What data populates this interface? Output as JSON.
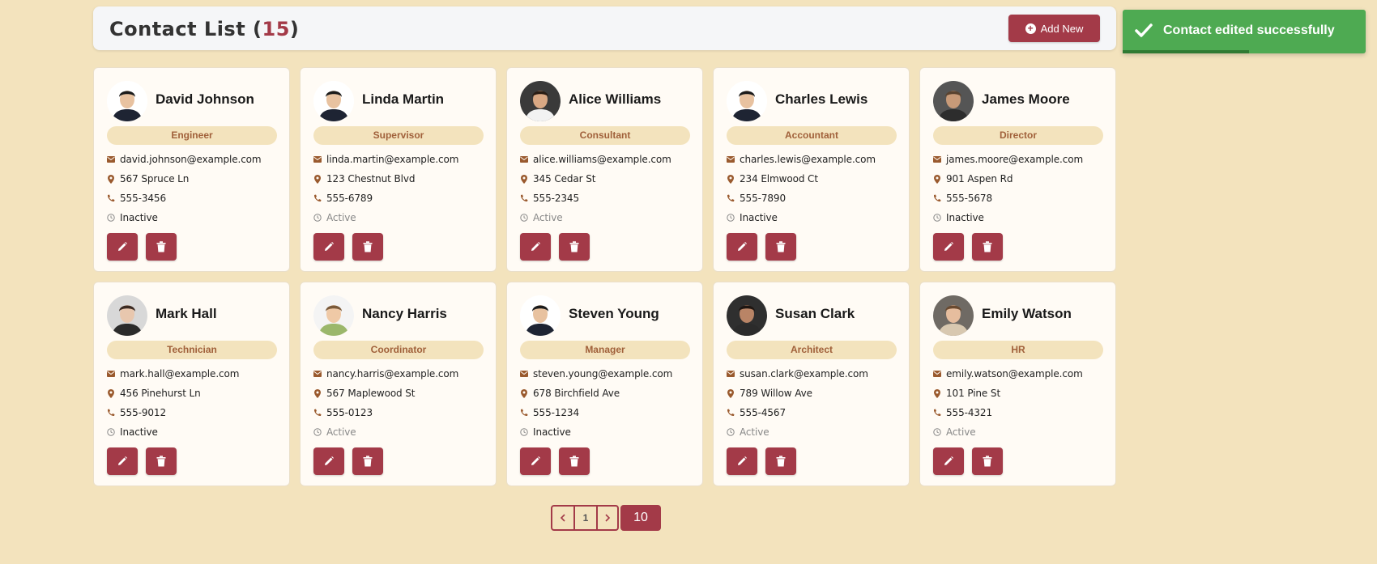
{
  "header": {
    "title": "Contact List",
    "count_open": "(",
    "count": "15",
    "count_close": ")",
    "add_label": "Add New"
  },
  "toast": {
    "message": "Contact edited successfully",
    "progress": 0.52
  },
  "colors": {
    "accent": "#a33a48",
    "background": "#f3e3bd",
    "toast": "#4eaa52",
    "role_text": "#a0603a"
  },
  "contacts": [
    {
      "name": "David Johnson",
      "role": "Engineer",
      "email": "david.johnson@example.com",
      "address": "567 Spruce Ln",
      "phone": "555-3456",
      "status": "Inactive",
      "avatar": "man-a"
    },
    {
      "name": "Linda Martin",
      "role": "Supervisor",
      "email": "linda.martin@example.com",
      "address": "123 Chestnut Blvd",
      "phone": "555-6789",
      "status": "Active",
      "avatar": "man-a"
    },
    {
      "name": "Alice Williams",
      "role": "Consultant",
      "email": "alice.williams@example.com",
      "address": "345 Cedar St",
      "phone": "555-2345",
      "status": "Active",
      "avatar": "footballer"
    },
    {
      "name": "Charles Lewis",
      "role": "Accountant",
      "email": "charles.lewis@example.com",
      "address": "234 Elmwood Ct",
      "phone": "555-7890",
      "status": "Inactive",
      "avatar": "man-a"
    },
    {
      "name": "James Moore",
      "role": "Director",
      "email": "james.moore@example.com",
      "address": "901 Aspen Rd",
      "phone": "555-5678",
      "status": "Inactive",
      "avatar": "man-curly"
    },
    {
      "name": "Mark Hall",
      "role": "Technician",
      "email": "mark.hall@example.com",
      "address": "456 Pinehurst Ln",
      "phone": "555-9012",
      "status": "Inactive",
      "avatar": "woman-short"
    },
    {
      "name": "Nancy Harris",
      "role": "Coordinator",
      "email": "nancy.harris@example.com",
      "address": "567 Maplewood St",
      "phone": "555-0123",
      "status": "Active",
      "avatar": "child"
    },
    {
      "name": "Steven Young",
      "role": "Manager",
      "email": "steven.young@example.com",
      "address": "678 Birchfield Ave",
      "phone": "555-1234",
      "status": "Inactive",
      "avatar": "man-a"
    },
    {
      "name": "Susan Clark",
      "role": "Architect",
      "email": "susan.clark@example.com",
      "address": "789 Willow Ave",
      "phone": "555-4567",
      "status": "Active",
      "avatar": "woman-dark"
    },
    {
      "name": "Emily Watson",
      "role": "HR",
      "email": "emily.watson@example.com",
      "address": "101 Pine St",
      "phone": "555-4321",
      "status": "Active",
      "avatar": "woman-long"
    }
  ],
  "pagination": {
    "current_page": "1",
    "page_size": "10"
  }
}
